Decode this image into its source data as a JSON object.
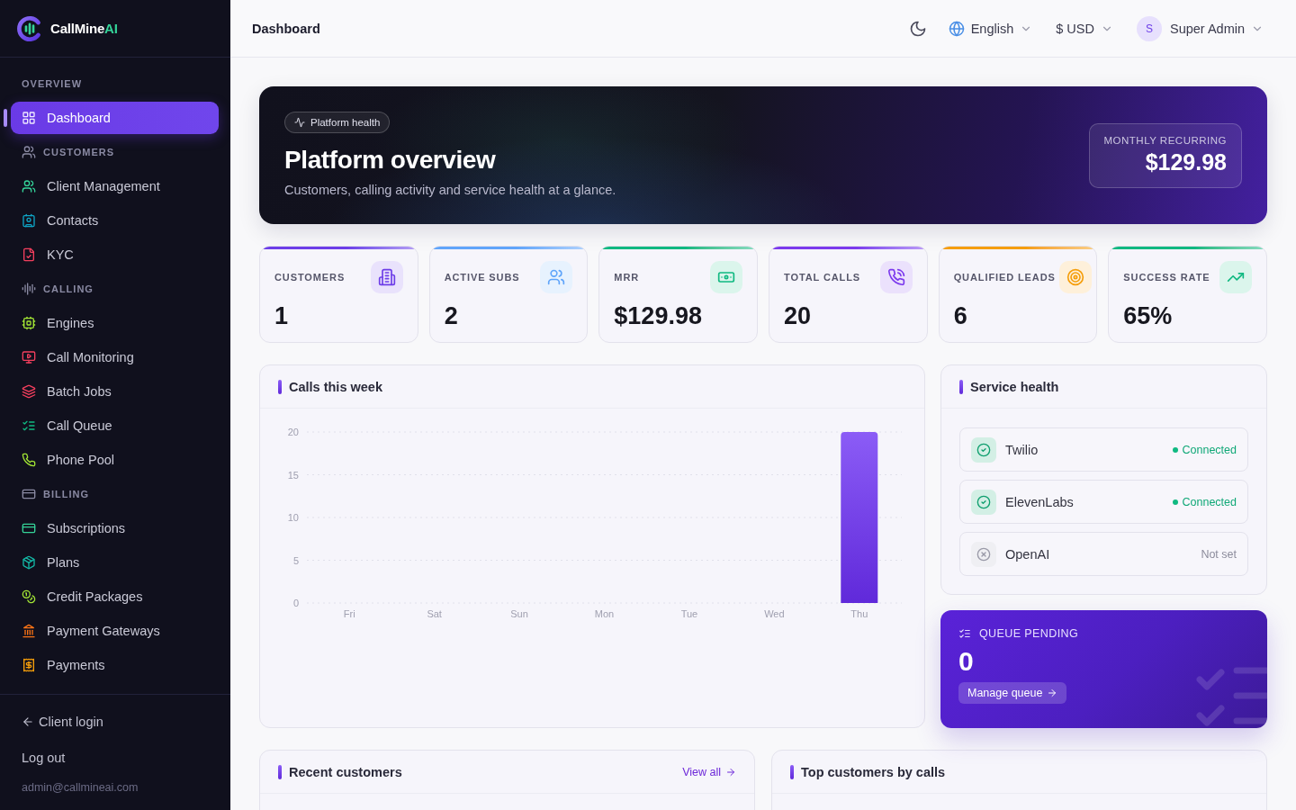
{
  "sidebar": {
    "brand": {
      "name": "CallMine",
      "accent": "AI"
    },
    "sections": [
      {
        "label": "OVERVIEW",
        "items": [
          {
            "label": "Dashboard",
            "selected": true
          }
        ]
      },
      {
        "label": "CUSTOMERS",
        "items": [
          {
            "label": "Client Management",
            "selected": false
          },
          {
            "label": "Contacts",
            "selected": false
          },
          {
            "label": "KYC",
            "selected": false
          }
        ]
      },
      {
        "label": "CALLING",
        "items": [
          {
            "label": "Engines",
            "selected": false
          },
          {
            "label": "Call Monitoring",
            "selected": false
          },
          {
            "label": "Batch Jobs",
            "selected": false
          },
          {
            "label": "Call Queue",
            "selected": false
          },
          {
            "label": "Phone Pool",
            "selected": false
          }
        ]
      },
      {
        "label": "BILLING",
        "items": [
          {
            "label": "Subscriptions",
            "selected": false
          },
          {
            "label": "Plans",
            "selected": false
          },
          {
            "label": "Credit Packages",
            "selected": false
          },
          {
            "label": "Payment Gateways",
            "selected": false
          },
          {
            "label": "Payments",
            "selected": false
          }
        ]
      }
    ],
    "footer": {
      "client_login": "Client login",
      "logout": "Log out",
      "email": "admin@callmineai.com"
    }
  },
  "header": {
    "title": "Dashboard",
    "language": "English",
    "currency": "$ USD",
    "user": {
      "initial": "S",
      "name": "Super Admin"
    }
  },
  "banner": {
    "badge": "Platform health",
    "title": "Platform overview",
    "subtitle": "Customers, calling activity and service health at a glance.",
    "metric": {
      "label": "MONTHLY RECURRING",
      "value": "$129.98"
    }
  },
  "stats": [
    {
      "label": "CUSTOMERS",
      "value": "1",
      "color": "#6d3ee8"
    },
    {
      "label": "ACTIVE SUBS",
      "value": "2",
      "color": "#60a5fa"
    },
    {
      "label": "MRR",
      "value": "$129.98",
      "color": "#10b981"
    },
    {
      "label": "TOTAL CALLS",
      "value": "20",
      "color": "#7c3aed"
    },
    {
      "label": "QUALIFIED LEADS",
      "value": "6",
      "color": "#f59e0b"
    },
    {
      "label": "SUCCESS RATE",
      "value": "65%",
      "color": "#10b981"
    }
  ],
  "calls_chart": {
    "chart_data": {
      "type": "bar",
      "title": "Calls this week",
      "categories": [
        "Fri",
        "Sat",
        "Sun",
        "Mon",
        "Tue",
        "Wed",
        "Thu"
      ],
      "values": [
        0,
        0,
        0,
        0,
        0,
        0,
        20
      ],
      "ylim": [
        0,
        20
      ],
      "yticks": [
        0,
        5,
        10,
        15,
        20
      ],
      "grid": true
    }
  },
  "service_health": {
    "title": "Service health",
    "services": [
      {
        "name": "Twilio",
        "status": "Connected",
        "connected": true
      },
      {
        "name": "ElevenLabs",
        "status": "Connected",
        "connected": true
      },
      {
        "name": "OpenAI",
        "status": "Not set",
        "connected": false
      }
    ]
  },
  "queue": {
    "label": "QUEUE PENDING",
    "value": "0",
    "action": "Manage queue"
  },
  "recent_customers": {
    "title": "Recent customers",
    "link": "View all"
  },
  "top_customers": {
    "title": "Top customers by calls"
  }
}
